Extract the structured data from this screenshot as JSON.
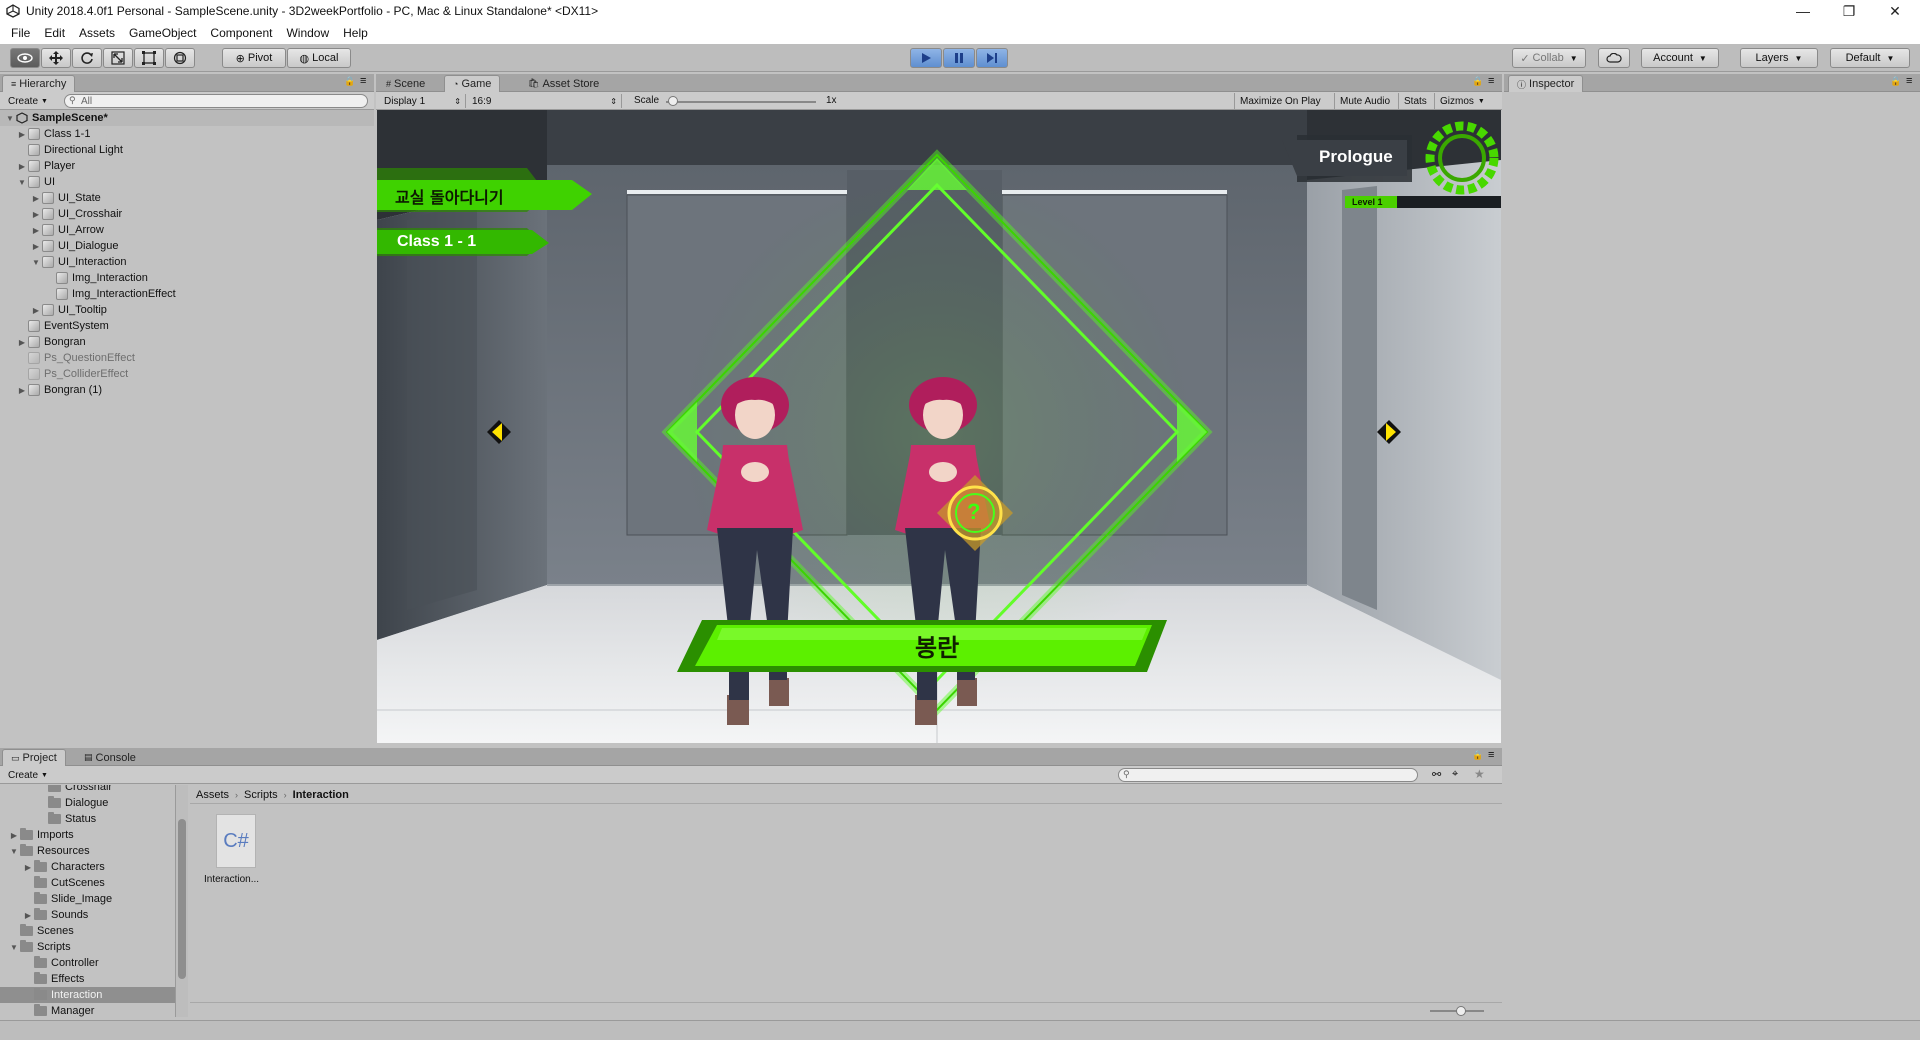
{
  "window": {
    "title": "Unity 2018.4.0f1 Personal - SampleScene.unity - 3D2weekPortfolio - PC, Mac & Linux Standalone* <DX11>",
    "minimize": "—",
    "maximize": "❐",
    "close": "✕"
  },
  "menu": [
    "File",
    "Edit",
    "Assets",
    "GameObject",
    "Component",
    "Window",
    "Help"
  ],
  "toolbar": {
    "pivot": "Pivot",
    "local": "Local",
    "collab": "Collab",
    "account": "Account",
    "layers": "Layers",
    "layout": "Default"
  },
  "hierarchy": {
    "tab": "Hierarchy",
    "create": "Create",
    "search_placeholder": "All",
    "scene": "SampleScene*",
    "items": [
      {
        "label": "Class 1-1",
        "indent": 0,
        "arrow": "▶",
        "dim": false
      },
      {
        "label": "Directional Light",
        "indent": 0,
        "arrow": "",
        "dim": false
      },
      {
        "label": "Player",
        "indent": 0,
        "arrow": "▶",
        "dim": false
      },
      {
        "label": "UI",
        "indent": 0,
        "arrow": "▼",
        "dim": false
      },
      {
        "label": "UI_State",
        "indent": 1,
        "arrow": "▶",
        "dim": false
      },
      {
        "label": "UI_Crosshair",
        "indent": 1,
        "arrow": "▶",
        "dim": false
      },
      {
        "label": "UI_Arrow",
        "indent": 1,
        "arrow": "▶",
        "dim": false
      },
      {
        "label": "UI_Dialogue",
        "indent": 1,
        "arrow": "▶",
        "dim": false
      },
      {
        "label": "UI_Interaction",
        "indent": 1,
        "arrow": "▼",
        "dim": false
      },
      {
        "label": "Img_Interaction",
        "indent": 2,
        "arrow": "",
        "dim": false
      },
      {
        "label": "Img_InteractionEffect",
        "indent": 2,
        "arrow": "",
        "dim": false
      },
      {
        "label": "UI_Tooltip",
        "indent": 1,
        "arrow": "▶",
        "dim": false
      },
      {
        "label": "EventSystem",
        "indent": 0,
        "arrow": "",
        "dim": false
      },
      {
        "label": "Bongran",
        "indent": 0,
        "arrow": "▶",
        "dim": false
      },
      {
        "label": "Ps_QuestionEffect",
        "indent": 0,
        "arrow": "",
        "dim": true
      },
      {
        "label": "Ps_ColliderEffect",
        "indent": 0,
        "arrow": "",
        "dim": true
      },
      {
        "label": "Bongran (1)",
        "indent": 0,
        "arrow": "▶",
        "dim": false
      }
    ]
  },
  "view": {
    "tabs": [
      "Scene",
      "Game",
      "Asset Store"
    ],
    "display": "Display 1",
    "aspect": "16:9",
    "scale_label": "Scale",
    "scale_value": "1x",
    "maximize_on_play": "Maximize On Play",
    "mute_audio": "Mute Audio",
    "stats": "Stats",
    "gizmos": "Gizmos"
  },
  "game": {
    "location_korean": "교실 돌아다니기",
    "location_class": "Class 1 - 1",
    "chapter": "Prologue",
    "level": "Level 1",
    "character_name": "봉란",
    "question_mark": "?"
  },
  "inspector": {
    "tab": "Inspector"
  },
  "project": {
    "tabs": [
      "Project",
      "Console"
    ],
    "create": "Create",
    "breadcrumb": [
      "Assets",
      "Scripts",
      "Interaction"
    ],
    "tree": [
      {
        "label": "Crosshair",
        "indent": 3,
        "arrow": ""
      },
      {
        "label": "Dialogue",
        "indent": 3,
        "arrow": ""
      },
      {
        "label": "Status",
        "indent": 3,
        "arrow": ""
      },
      {
        "label": "Imports",
        "indent": 1,
        "arrow": "▶"
      },
      {
        "label": "Resources",
        "indent": 1,
        "arrow": "▼"
      },
      {
        "label": "Characters",
        "indent": 2,
        "arrow": "▶"
      },
      {
        "label": "CutScenes",
        "indent": 2,
        "arrow": ""
      },
      {
        "label": "Slide_Image",
        "indent": 2,
        "arrow": ""
      },
      {
        "label": "Sounds",
        "indent": 2,
        "arrow": "▶"
      },
      {
        "label": "Scenes",
        "indent": 1,
        "arrow": ""
      },
      {
        "label": "Scripts",
        "indent": 1,
        "arrow": "▼"
      },
      {
        "label": "Controller",
        "indent": 2,
        "arrow": ""
      },
      {
        "label": "Effects",
        "indent": 2,
        "arrow": ""
      },
      {
        "label": "Interaction",
        "indent": 2,
        "arrow": "",
        "selected": true
      },
      {
        "label": "Manager",
        "indent": 2,
        "arrow": ""
      }
    ],
    "asset_icon": "C#",
    "asset_name": "Interaction..."
  }
}
